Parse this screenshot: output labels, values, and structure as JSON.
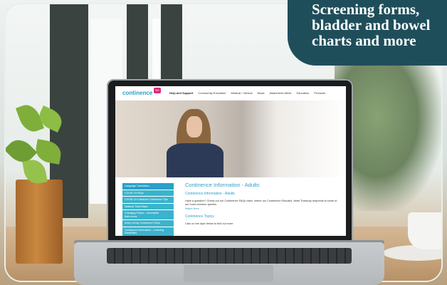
{
  "banner": {
    "lines": [
      "Screening forms,",
      "bladder and bowel",
      "charts and more"
    ]
  },
  "website": {
    "logo_text": "continence",
    "logo_badge": "NZ",
    "nav_items": [
      {
        "label": "Help and Support",
        "active": true
      },
      {
        "label": "Community Education",
        "active": false
      },
      {
        "label": "Medical / Clinical",
        "active": false
      },
      {
        "label": "News",
        "active": false
      },
      {
        "label": "Awareness Week",
        "active": false
      },
      {
        "label": "Education",
        "active": false
      },
      {
        "label": "Products",
        "active": false
      }
    ],
    "side_menu": [
      "Language Translation",
      "COVID-19 FAQs",
      "COVID-19 Lockdown Continence Tips",
      "National Toilet Maps",
      "Changing Places – Accessible Bathrooms",
      "Motor Dentry Continence FAQs",
      "Continence Information – Learning Disabilities"
    ],
    "content_title": "Continence Information - Adults",
    "section1_heading": "Continence Information - Adults",
    "section1_text": "Have a question? Check out our Continence FAQs video, where our Continence Educator Janet Thaxbury responds to some of our most common queries.",
    "section1_link": "Watch Here",
    "section2_heading": "Continence Topics",
    "section2_text": "Click on the topic below to find out more"
  }
}
